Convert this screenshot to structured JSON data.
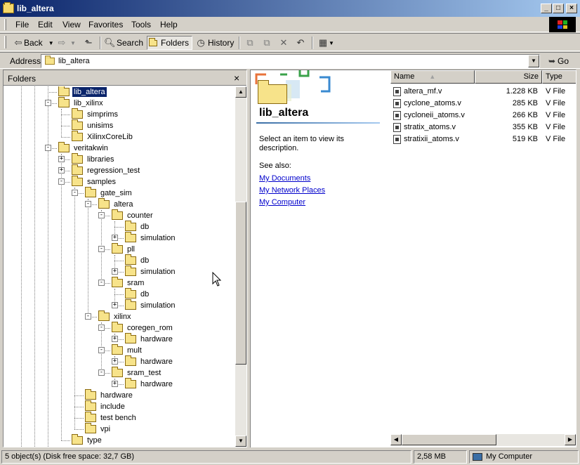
{
  "window": {
    "title": "lib_altera",
    "caption_buttons": {
      "minimize": "_",
      "maximize": "□",
      "close": "×"
    }
  },
  "menu": [
    "File",
    "Edit",
    "View",
    "Favorites",
    "Tools",
    "Help"
  ],
  "toolbar": {
    "back": "Back",
    "search": "Search",
    "folders": "Folders",
    "history": "History"
  },
  "address": {
    "label": "Address",
    "value": "lib_altera",
    "go": "Go"
  },
  "folders_pane": {
    "title": "Folders",
    "close": "×",
    "nodes": [
      {
        "label": "lib_altera",
        "expander": "",
        "selected": true
      },
      {
        "label": "lib_xilinx",
        "expander": "-"
      },
      {
        "label": "simprims",
        "expander": ""
      },
      {
        "label": "unisims",
        "expander": ""
      },
      {
        "label": "XilinxCoreLib",
        "expander": ""
      },
      {
        "label": "veritakwin",
        "expander": "-"
      },
      {
        "label": "libraries",
        "expander": "+"
      },
      {
        "label": "regression_test",
        "expander": "+"
      },
      {
        "label": "samples",
        "expander": "-"
      },
      {
        "label": "gate_sim",
        "expander": "-"
      },
      {
        "label": "altera",
        "expander": "-"
      },
      {
        "label": "counter",
        "expander": "-"
      },
      {
        "label": "db",
        "expander": ""
      },
      {
        "label": "simulation",
        "expander": "+"
      },
      {
        "label": "pll",
        "expander": "-"
      },
      {
        "label": "db",
        "expander": ""
      },
      {
        "label": "simulation",
        "expander": "+"
      },
      {
        "label": "sram",
        "expander": "-"
      },
      {
        "label": "db",
        "expander": ""
      },
      {
        "label": "simulation",
        "expander": "+"
      },
      {
        "label": "xilinx",
        "expander": "-"
      },
      {
        "label": "coregen_rom",
        "expander": "-"
      },
      {
        "label": "hardware",
        "expander": "+"
      },
      {
        "label": "mult",
        "expander": "-"
      },
      {
        "label": "hardware",
        "expander": "+"
      },
      {
        "label": "sram_test",
        "expander": "-"
      },
      {
        "label": "hardware",
        "expander": "+"
      },
      {
        "label": "hardware",
        "expander": ""
      },
      {
        "label": "include",
        "expander": ""
      },
      {
        "label": "test bench",
        "expander": ""
      },
      {
        "label": "vpi",
        "expander": ""
      },
      {
        "label": "type",
        "expander": ""
      }
    ]
  },
  "webview": {
    "folder_name": "lib_altera",
    "description": "Select an item to view its description.",
    "see_also": "See also:",
    "links": [
      "My Documents",
      "My Network Places",
      "My Computer"
    ]
  },
  "filelist": {
    "columns": {
      "name": "Name",
      "size": "Size",
      "type": "Type"
    },
    "files": [
      {
        "name": "altera_mf.v",
        "size": "1.228 KB",
        "type": "V File"
      },
      {
        "name": "cyclone_atoms.v",
        "size": "285 KB",
        "type": "V File"
      },
      {
        "name": "cycloneii_atoms.v",
        "size": "266 KB",
        "type": "V File"
      },
      {
        "name": "stratix_atoms.v",
        "size": "355 KB",
        "type": "V File"
      },
      {
        "name": "stratixii_atoms.v",
        "size": "519 KB",
        "type": "V File"
      }
    ]
  },
  "statusbar": {
    "objects": "5 object(s) (Disk free space: 32,7 GB)",
    "size": "2,58 MB",
    "zone": "My Computer"
  },
  "colors": {
    "title_start": "#0a246a",
    "title_end": "#a6caf0",
    "face": "#d4d0c8",
    "selection": "#0a246a",
    "link": "#0000cc"
  }
}
